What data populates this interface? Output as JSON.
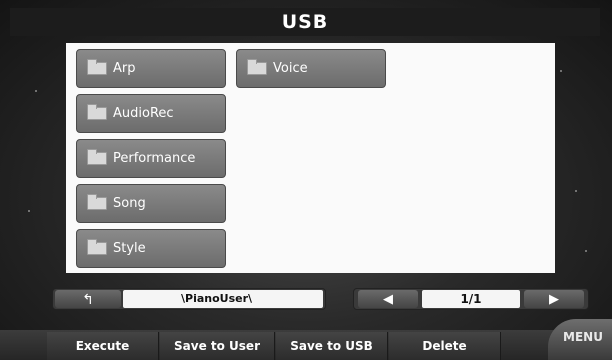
{
  "title": "USB",
  "folders": [
    {
      "name": "Arp",
      "icon": "folder-icon"
    },
    {
      "name": "AudioRec",
      "icon": "folder-icon"
    },
    {
      "name": "Performance",
      "icon": "folder-icon"
    },
    {
      "name": "Song",
      "icon": "folder-icon"
    },
    {
      "name": "Style",
      "icon": "folder-icon"
    },
    {
      "name": "Voice",
      "icon": "folder-icon"
    }
  ],
  "navigation": {
    "back_icon": "back-arrow-icon",
    "back_glyph": "↰",
    "path": "\\PianoUser\\",
    "prev_glyph": "◀",
    "next_glyph": "▶",
    "page": "1/1"
  },
  "functions": {
    "execute": "Execute",
    "save_to_user": "Save to User",
    "save_to_usb": "Save to USB",
    "delete": "Delete",
    "menu": "MENU"
  }
}
